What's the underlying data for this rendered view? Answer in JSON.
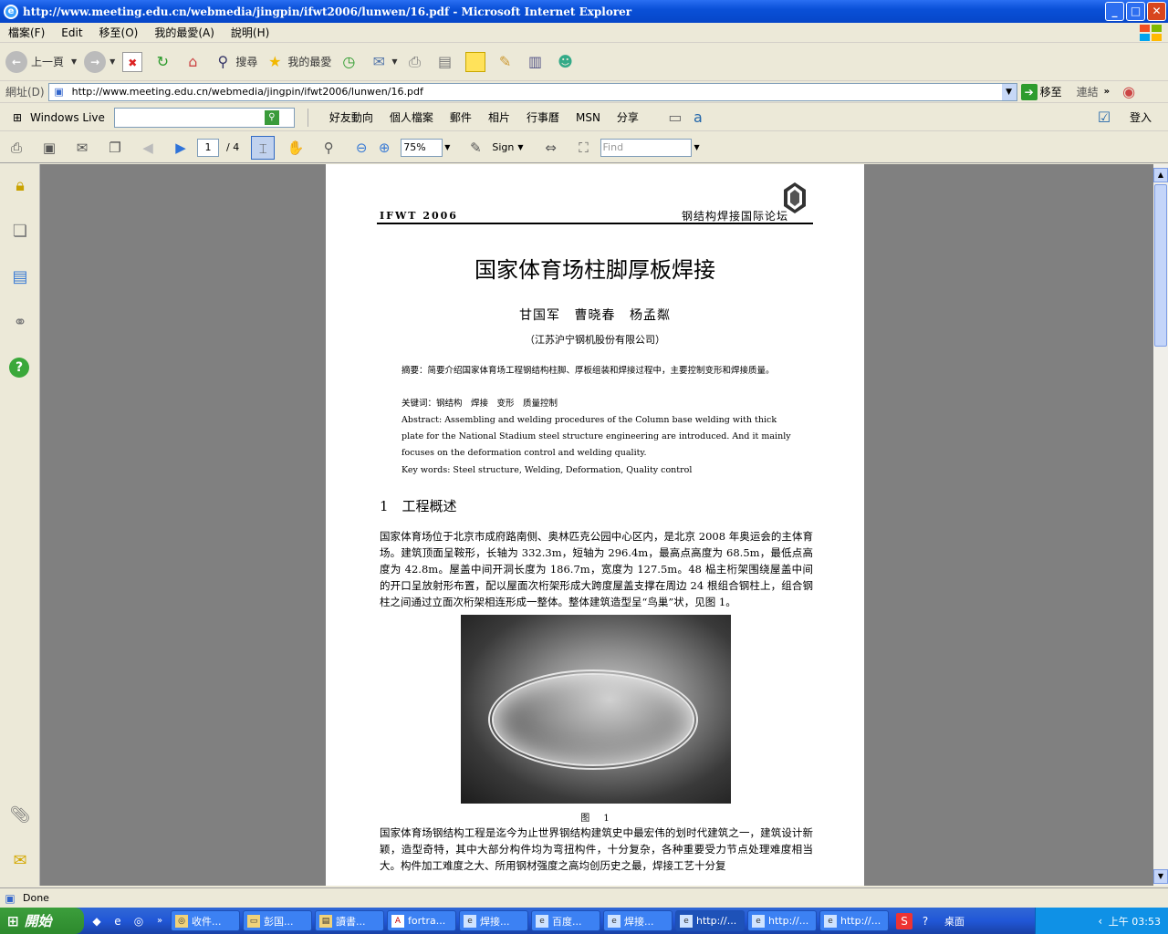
{
  "window": {
    "title": "http://www.meeting.edu.cn/webmedia/jingpin/ifwt2006/lunwen/16.pdf - Microsoft Internet Explorer",
    "min": "_",
    "max": "□",
    "close": "✕"
  },
  "menu": [
    "檔案(F)",
    "Edit",
    "移至(O)",
    "我的最愛(A)",
    "說明(H)"
  ],
  "toolbar": {
    "back": "上一頁",
    "search": "搜尋",
    "favorites": "我的最愛"
  },
  "address": {
    "label": "網址(D)",
    "url": "http://www.meeting.edu.cn/webmedia/jingpin/ifwt2006/lunwen/16.pdf",
    "go": "移至",
    "links": "連結"
  },
  "live": {
    "brand": "Windows Live",
    "items": [
      "好友動向",
      "個人檔案",
      "郵件",
      "相片",
      "行事曆",
      "MSN",
      "分享"
    ],
    "signin": "登入"
  },
  "pdf": {
    "page_current": "1",
    "page_total": "/ 4",
    "zoom": "75%",
    "sign": "Sign",
    "find_placeholder": "Find"
  },
  "document": {
    "header_left": "IFWT 2006",
    "header_right": "钢结构焊接国际论坛",
    "title": "国家体育场柱脚厚板焊接",
    "authors": "甘国军 曹晓春 杨孟粼",
    "affiliation": "（江苏沪宁钢机股份有限公司）",
    "abstract_cn": "摘要：简要介绍国家体育场工程钢结构柱脚、厚板组装和焊接过程中，主要控制变形和焊接质量。",
    "keywords_cn": "关键词：钢结构　焊接　变形　质量控制",
    "abstract_en": "Abstract: Assembling and welding procedures of the Column base welding with thick plate for the National Stadium steel structure engineering are introduced. And it mainly focuses on the deformation control and welding quality.",
    "keywords_en": "Key words: Steel structure, Welding, Deformation, Quality control",
    "section": "1　工程概述",
    "para1": "国家体育场位于北京市成府路南侧、奥林匹克公园中心区内，是北京 2008 年奥运会的主体育场。建筑顶面呈鞍形，长轴为 332.3m，短轴为 296.4m，最高点高度为 68.5m，最低点高度为 42.8m。屋盖中间开洞长度为 186.7m，宽度为 127.5m。48 榀主桁架围绕屋盖中间的开口呈放射形布置，配以屋面次桁架形成大跨度屋盖支撑在周边 24 根组合钢柱上，组合钢柱之间通过立面次桁架相连形成一整体。整体建筑造型呈“鸟巢”状，见图 1。",
    "figure_caption": "图 1",
    "para2": "国家体育场钢结构工程是迄今为止世界钢结构建筑史中最宏伟的划时代建筑之一，建筑设计新颖，造型奇特，其中大部分构件均为弯扭构件，十分复杂，各种重要受力节点处理难度相当大。构件加工难度之大、所用钢材强度之高均创历史之最，焊接工艺十分复"
  },
  "status": {
    "text": "Done"
  },
  "taskbar": {
    "start": "開始",
    "items": [
      "收件...",
      "彭国...",
      "讀書...",
      "fortra...",
      "焊接...",
      "百度...",
      "焊接...",
      "http://...",
      "http://...",
      "http://..."
    ],
    "desktop": "桌面",
    "clock": "上午 03:53"
  }
}
